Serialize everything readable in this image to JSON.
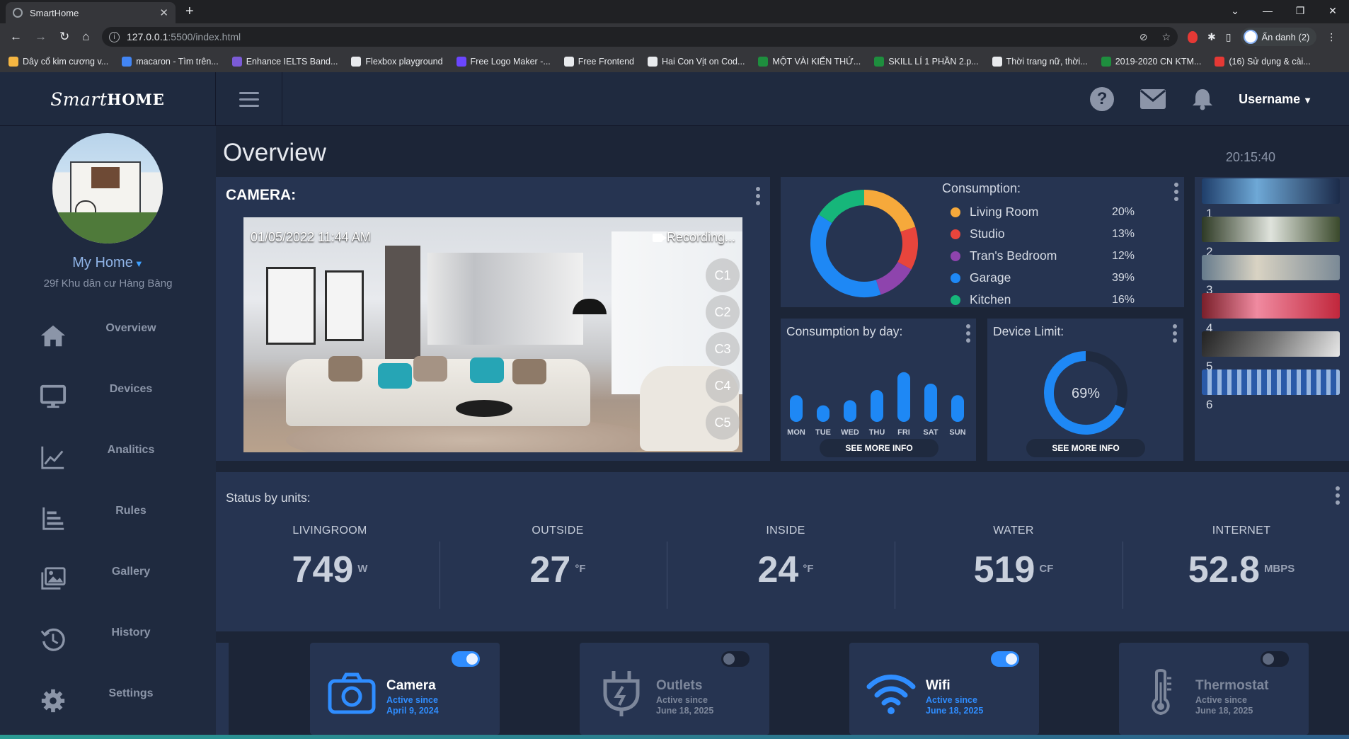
{
  "browser": {
    "tab_title": "SmartHome",
    "url_host": "127.0.0.1",
    "url_path": ":5500/index.html",
    "profile_label": "Ẩn danh (2)",
    "bookmarks": [
      "Dây cổ kim cương v...",
      "macaron - Tìm trên...",
      "Enhance IELTS Band...",
      "Flexbox playground",
      "Free Logo Maker -...",
      "Free Frontend",
      "Hai Con Vịt on Cod...",
      "MỘT VÀI KIẾN THỨ...",
      "SKILL LÍ 1 PHẦN 2.p...",
      "Thời trang nữ, thời...",
      "2019-2020 CN KTM...",
      "(16) Sử dụng & cài..."
    ]
  },
  "header": {
    "logo_script": "Smart",
    "logo_bold": "HOME",
    "username": "Username"
  },
  "sidebar": {
    "home_name": "My Home",
    "address": "29f Khu dân cư Hàng Bàng",
    "items": [
      {
        "label": "Overview",
        "icon": "home-icon"
      },
      {
        "label": "Devices",
        "icon": "monitor-icon"
      },
      {
        "label": "Analitics",
        "icon": "line-chart-icon"
      },
      {
        "label": "Rules",
        "icon": "bar-list-icon"
      },
      {
        "label": "Gallery",
        "icon": "images-icon"
      },
      {
        "label": "History",
        "icon": "history-icon"
      },
      {
        "label": "Settings",
        "icon": "gear-icon"
      }
    ]
  },
  "main": {
    "title": "Overview",
    "time": "20:15:40",
    "camera": {
      "title": "CAMERA:",
      "timestamp": "01/05/2022  11:44 AM",
      "recording": "Recording...",
      "channels": [
        "C1",
        "C2",
        "C3",
        "C4",
        "C5"
      ]
    },
    "consumption": {
      "title": "Consumption:",
      "items": [
        {
          "name": "Living Room",
          "percent": "20%",
          "value": 20,
          "color": "#f6a93b"
        },
        {
          "name": "Studio",
          "percent": "13%",
          "value": 13,
          "color": "#e8453c"
        },
        {
          "name": "Tran's Bedroom",
          "percent": "12%",
          "value": 12,
          "color": "#8e44ad"
        },
        {
          "name": "Garage",
          "percent": "39%",
          "value": 39,
          "color": "#1e88f5"
        },
        {
          "name": "Kitchen",
          "percent": "16%",
          "value": 16,
          "color": "#16b67a"
        }
      ]
    },
    "by_day": {
      "title": "Consumption by day:",
      "see_more": "SEE MORE INFO",
      "days": [
        "MON",
        "TUE",
        "WED",
        "THU",
        "FRI",
        "SAT",
        "SUN"
      ],
      "values": [
        42,
        26,
        34,
        50,
        78,
        60,
        42
      ]
    },
    "device_limit": {
      "title": "Device Limit:",
      "value_label": "69%",
      "value": 69,
      "see_more": "SEE MORE INFO"
    },
    "gallery_numbers": [
      "1",
      "2",
      "3",
      "4",
      "5",
      "6"
    ],
    "status": {
      "title": "Status by units:",
      "units": [
        {
          "label": "LIVINGROOM",
          "value": "749",
          "unit": "W"
        },
        {
          "label": "OUTSIDE",
          "value": "27",
          "unit": "°F"
        },
        {
          "label": "INSIDE",
          "value": "24",
          "unit": "°F"
        },
        {
          "label": "WATER",
          "value": "519",
          "unit": "CF"
        },
        {
          "label": "INTERNET",
          "value": "52.8",
          "unit": "MBPS"
        }
      ]
    },
    "devices": [
      {
        "name": "Camera",
        "since": "Active since",
        "date": "April 9, 2024",
        "on": true
      },
      {
        "name": "Outlets",
        "since": "Active since",
        "date": "June 18, 2025",
        "on": false
      },
      {
        "name": "Wifi",
        "since": "Active since",
        "date": "June 18, 2025",
        "on": true
      },
      {
        "name": "Thermostat",
        "since": "Active since",
        "date": "June 18, 2025",
        "on": false
      }
    ]
  },
  "colors": {
    "accent": "#2f8dff",
    "card": "#263451",
    "bg": "#1c2537"
  }
}
